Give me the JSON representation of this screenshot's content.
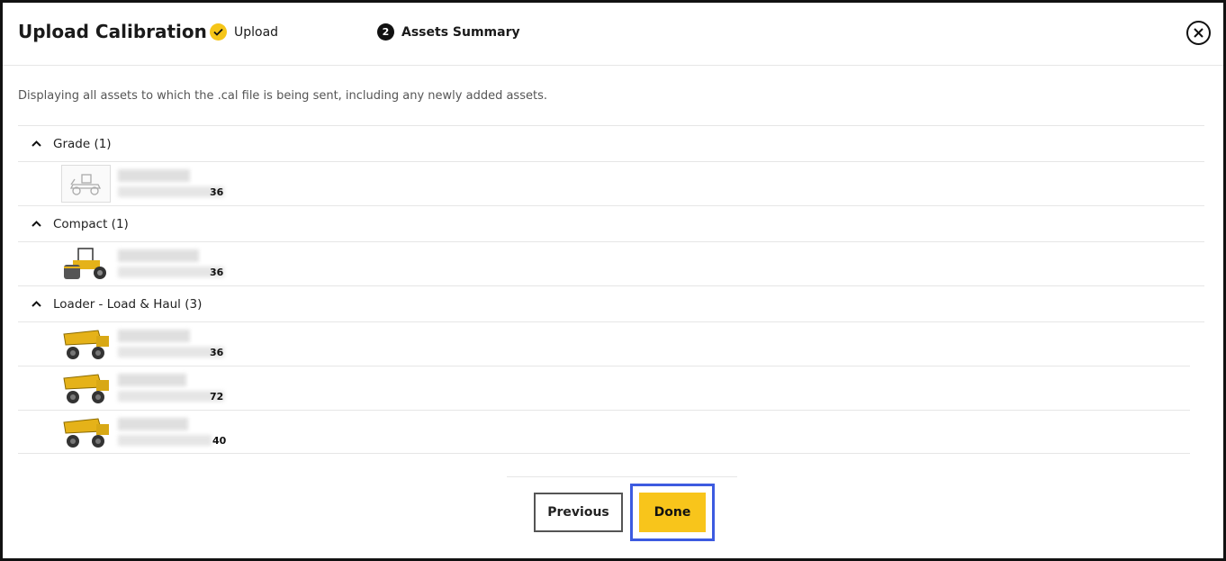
{
  "header": {
    "title": "Upload Calibration",
    "steps": [
      {
        "label": "Upload",
        "state": "complete"
      },
      {
        "number": "2",
        "label": "Assets Summary",
        "state": "active"
      }
    ]
  },
  "description": "Displaying all assets to which the .cal file is being sent, including any newly added assets.",
  "groups": [
    {
      "label": "Grade (1)",
      "assets": [
        {
          "id_suffix": "36",
          "icon": "grader-placeholder-icon"
        }
      ]
    },
    {
      "label": "Compact (1)",
      "assets": [
        {
          "id_suffix": "36",
          "icon": "compactor-icon"
        }
      ]
    },
    {
      "label": "Loader - Load & Haul (3)",
      "assets": [
        {
          "id_suffix": "36",
          "icon": "haul-truck-icon"
        },
        {
          "id_suffix": "72",
          "icon": "haul-truck-icon"
        },
        {
          "id_suffix": "40",
          "icon": "haul-truck-icon"
        }
      ]
    }
  ],
  "buttons": {
    "previous": "Previous",
    "done": "Done"
  },
  "colors": {
    "accent": "#f8c51b",
    "focus": "#3d5be0",
    "step_dark": "#111111"
  }
}
